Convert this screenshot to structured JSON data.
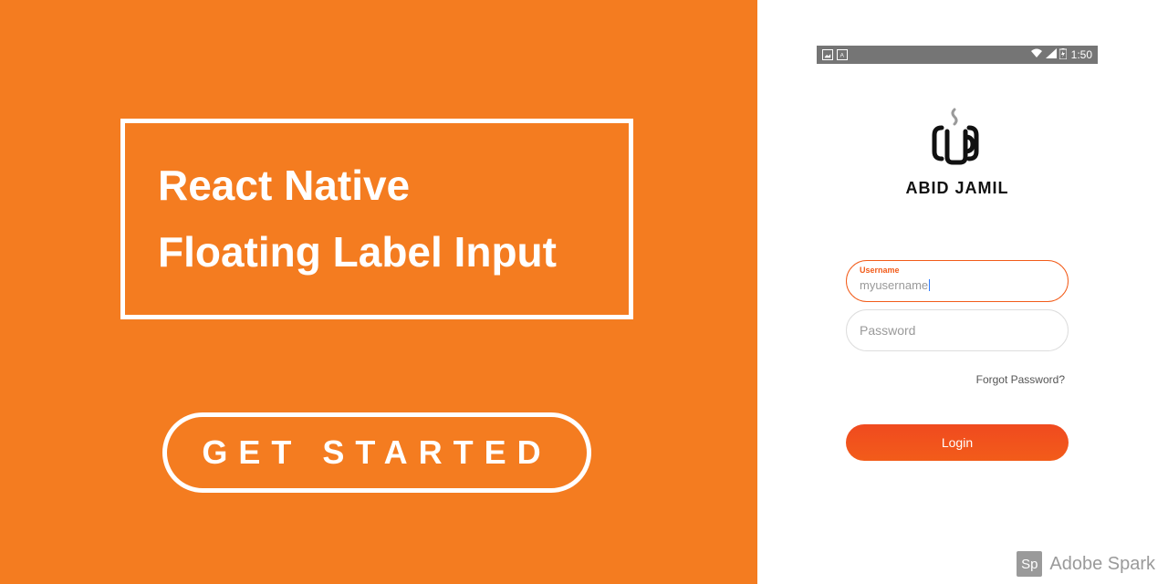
{
  "left": {
    "title_line1": "React Native",
    "title_line2": "Floating Label Input",
    "cta": "GET STARTED"
  },
  "phone": {
    "status": {
      "time": "1:50"
    },
    "logo_text": "ABID JAMIL",
    "form": {
      "username_label": "Username",
      "username_value": "myusername",
      "password_placeholder": "Password",
      "forgot": "Forgot Password?",
      "login_button": "Login"
    }
  },
  "watermark": {
    "prefix": "Sp",
    "brand": "Adobe Spark"
  },
  "colors": {
    "accent": "#f47c20",
    "button": "#f25c1a"
  }
}
